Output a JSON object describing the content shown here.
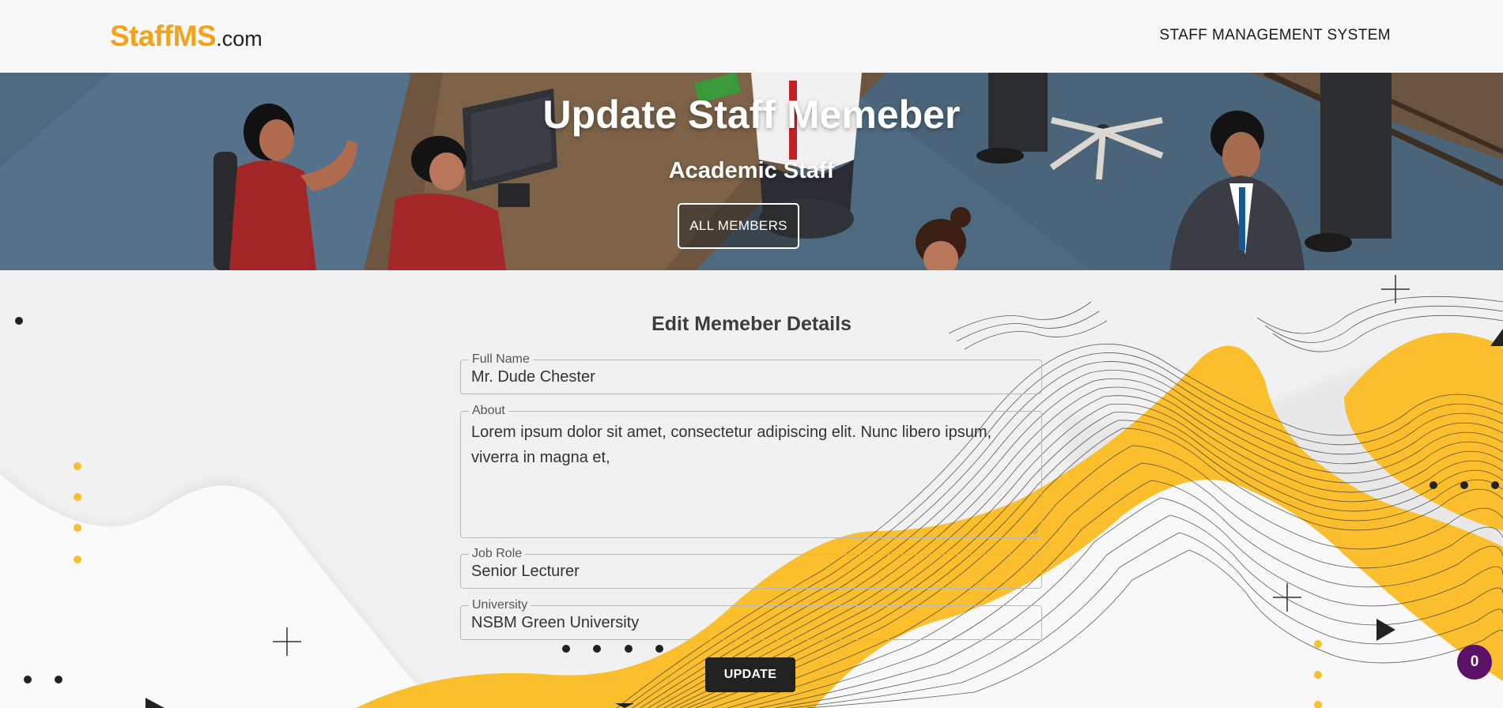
{
  "header": {
    "logo_brand": "StaffMS",
    "logo_domain": ".com",
    "title": "STAFF MANAGEMENT SYSTEM"
  },
  "hero": {
    "title": "Update Staff Memeber",
    "subtitle": "Academic Staff",
    "button_label": "ALL MEMBERS"
  },
  "form": {
    "title": "Edit Memeber Details",
    "fields": [
      {
        "label": "Full Name",
        "value": "Mr. Dude Chester"
      },
      {
        "label": "About",
        "value": "Lorem ipsum dolor sit amet, consectetur adipiscing elit. Nunc libero ipsum, viverra in magna et,"
      },
      {
        "label": "Job Role",
        "value": "Senior Lecturer"
      },
      {
        "label": "University",
        "value": "NSBM Green University"
      }
    ],
    "submit_label": "UPDATE"
  },
  "badge": {
    "count": "0"
  },
  "colors": {
    "brand": "#f5a21b",
    "accent_yellow": "#fbbf2e",
    "button_dark": "#222222",
    "badge": "#5b1168"
  }
}
